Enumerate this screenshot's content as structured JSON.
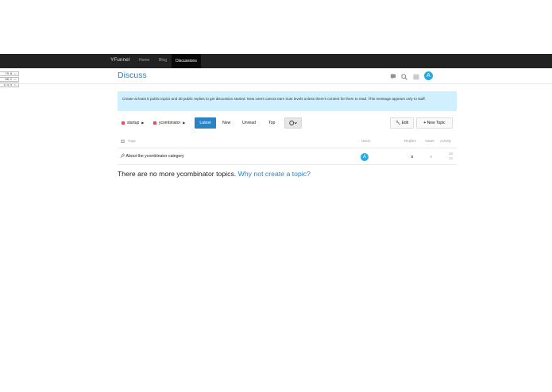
{
  "topnav": {
    "brand": "YFunnel",
    "links": [
      "Home",
      "Blog"
    ],
    "active": "Discussions"
  },
  "perf": [
    {
      "value": "79.8",
      "unit": "ms"
    },
    {
      "value": "60.2",
      "unit": "ms"
    },
    {
      "value": "374.9",
      "unit": "ms"
    }
  ],
  "header": {
    "title": "Discuss",
    "avatar_letter": "A"
  },
  "notice": {
    "text": "Create at least 5 public topics and 30 public replies to get discussion started. New users cannot earn trust levels unless there's content for them to read. This message appears only to staff."
  },
  "controls": {
    "crumbs": [
      {
        "label": "startup",
        "color": "#ed4c4c"
      },
      {
        "label": "ycombinator",
        "color": "#ed4c4c"
      }
    ],
    "tabs": [
      "Latest",
      "New",
      "Unread",
      "Top"
    ],
    "active_tab": "Latest",
    "edit_label": "Edit",
    "new_topic_label": "New Topic"
  },
  "table": {
    "headers": {
      "topic": "Topic",
      "users": "Users",
      "replies": "Replies",
      "views": "Views",
      "activity": "Activity"
    },
    "rows": [
      {
        "title": "About the ycombinator category",
        "user_letter": "A",
        "replies": "0",
        "views": "0",
        "activity_month": "Jul",
        "activity_day": "24"
      }
    ]
  },
  "footer": {
    "message": "There are no more ycombinator topics.",
    "link": "Why not create a topic?"
  },
  "colors": {
    "accent": "#2a83c5",
    "avatar": "#25aae1",
    "notice_bg": "#d1f0ff",
    "category": "#ed4c4c",
    "navbar": "#222222"
  }
}
